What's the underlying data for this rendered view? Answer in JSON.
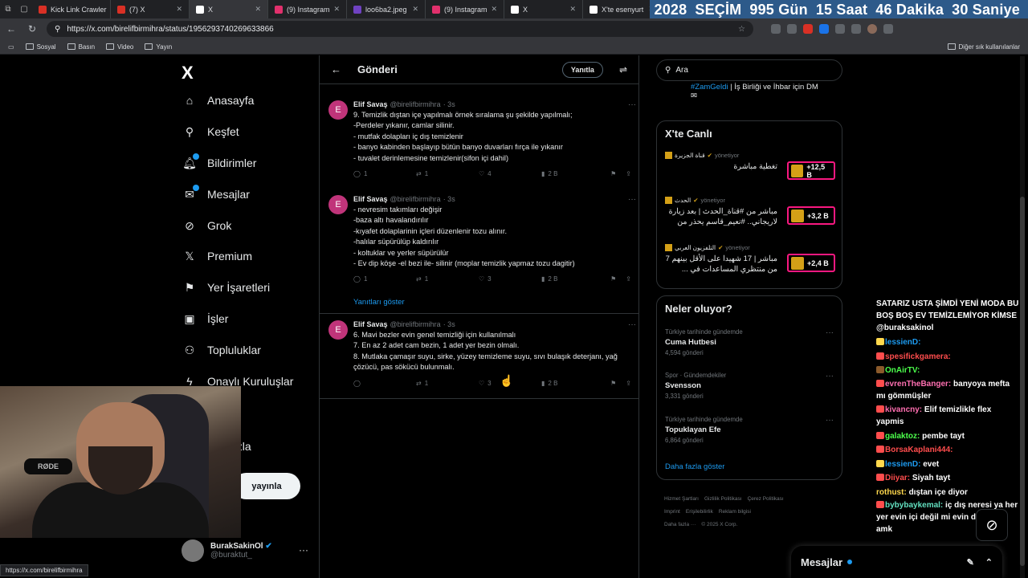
{
  "browser": {
    "tabs": [
      {
        "title": "Kick Link Crawler",
        "color": "#d93025"
      },
      {
        "title": "(7) X",
        "color": "#d93025"
      },
      {
        "title": "X",
        "color": "#ffffff"
      },
      {
        "title": "(9) Instagram",
        "color": "#e1306c"
      },
      {
        "title": "loo6ba2.jpeg",
        "color": "#6f42c1"
      },
      {
        "title": "(9) Instagram",
        "color": "#e1306c"
      },
      {
        "title": "X",
        "color": "#ffffff"
      },
      {
        "title": "X'te esenyurt",
        "color": "#ffffff"
      }
    ],
    "url": "https://x.com/birelifbirmihra/status/1956293740269633866",
    "bookmarks": [
      "Sosyal",
      "Basın",
      "Video",
      "Yayın"
    ],
    "other_bookmarks": "Diğer sık kullanılanlar",
    "status_url": "https://x.com/birelifbirmihra"
  },
  "countdown": {
    "year": "2028",
    "label": "SEÇİM",
    "days": "995 Gün",
    "hours": "15 Saat",
    "minutes": "46 Dakika",
    "seconds": "30 Saniye"
  },
  "nav": {
    "logo": "X",
    "items": [
      "Anasayfa",
      "Keşfet",
      "Bildirimler",
      "Mesajlar",
      "Grok",
      "Premium",
      "Yer İşaretleri",
      "İşler",
      "Topluluklar",
      "Onaylı Kuruluşlar"
    ],
    "more_fragment": "azla",
    "post_fragment": "yayınla",
    "account": {
      "name": "BurakSakinOl",
      "handle": "@buraktut_"
    }
  },
  "main": {
    "title": "Gönderi",
    "reply_button": "Yanıtla",
    "show_replies": "Yanıtları göster",
    "tweets": [
      {
        "avatar": "E",
        "name": "Elif Savaş",
        "handle": "@birelifbirmihra",
        "time": "· 3s",
        "text": "9. Temizlik dıştan içe yapılmalı örnek sıralama şu şekilde yapılmalı;\n-Perdeler yıkanır, camlar silinir.\n- mutfak dolapları iç dış temizlenir\n- banyo kabinden başlayıp bütün banyo duvarları fırça ile yıkanır\n- tuvalet derinlemesine temizlenir(sifon içi dahil)",
        "replies": "1",
        "reposts": "1",
        "likes": "4",
        "views": "2 B"
      },
      {
        "avatar": "E",
        "name": "Elif Savaş",
        "handle": "@birelifbirmihra",
        "time": "· 3s",
        "text": "- nevresim takımları değişir\n-baza altı havalandırılır\n-kıyafet dolaplarinin içleri düzenlenir tozu alınır.\n-halılar süpürülüp kaldırılır\n- koltuklar ve yerler süpürülür\n- Ev dip köşe -el bezi ile- silinir (moplar temizlik yapmaz tozu dagitir)",
        "replies": "1",
        "reposts": "1",
        "likes": "3",
        "views": "2 B"
      },
      {
        "avatar": "E",
        "name": "Elif Savaş",
        "handle": "@birelifbirmihra",
        "time": "· 3s",
        "text": "6. Mavi bezler evin genel temizliği için kullanılmalı\n7. En az 2 adet cam bezin, 1 adet yer bezin olmalı.\n8. Mutlaka çamaşır suyu, sirke, yüzey temizleme suyu, sıvı bulaşık deterjanı, yağ çözücü, pas sökücü bulunmalı.",
        "replies": "",
        "reposts": "1",
        "likes": "3",
        "views": "2 B"
      }
    ]
  },
  "right": {
    "search_placeholder": "Ara",
    "promo_tag": "#ZamGeldi",
    "promo_text": " | İş Birliği ve İhbar için DM",
    "live_title": "X'te Canlı",
    "live": [
      {
        "source": "قناة الجزيرة",
        "status": "yönetiyor",
        "text": "تغطية مباشرة",
        "count": "+12,5 B"
      },
      {
        "source": "الحدث",
        "status": "yönetiyor",
        "text": "مباشر من #قناة_الحدث | بعد زيارة لاريجاني.. #نعيم_قاسم يحذر من",
        "count": "+3,2 B"
      },
      {
        "source": "التلفزيون العربي",
        "status": "yönetiyor",
        "text": "مباشر | 17 شهيدا على الأقل بينهم 7 من منتظري المساعدات في ...",
        "count": "+2,4 B"
      }
    ],
    "trends_title": "Neler oluyor?",
    "trends": [
      {
        "category": "Türkiye tarihinde gündemde",
        "name": "Cuma Hutbesi",
        "count": "4,594 gönderi"
      },
      {
        "category": "Spor · Gündemdekiler",
        "name": "Svensson",
        "count": "3,331 gönderi"
      },
      {
        "category": "Türkiye tarihinde gündemde",
        "name": "Topuklayan Efe",
        "count": "6,864 gönderi"
      }
    ],
    "show_more": "Daha fazla göster",
    "footer": [
      "Hizmet Şartları",
      "Gizlilik Politikası",
      "Çerez Politikası",
      "Imprint",
      "Erişilebilirlik",
      "Reklam bilgisi",
      "Daha fazla ···",
      "© 2025 X Corp."
    ]
  },
  "chat": {
    "headline": "SATARIZ USTA ŞİMDİ YENİ MODA BU BOŞ BOŞ EV TEMİZLEMİYOR KİMSE @buraksakinol",
    "messages": [
      {
        "user": "lessienD:",
        "text": "",
        "color": "u-blue"
      },
      {
        "user": "spesifickgamera:",
        "text": "",
        "color": "u-red"
      },
      {
        "user": "OnAirTV:",
        "text": "",
        "color": "u-green"
      },
      {
        "user": "evrenTheBanger:",
        "text": "banyoya mefta mı gömmüşler",
        "color": "u-pink"
      },
      {
        "user": "kivancny:",
        "text": "Elif temizlikle flex yapmis",
        "color": "u-pink"
      },
      {
        "user": "galaktoz:",
        "text": "pembe tayt",
        "color": "u-green"
      },
      {
        "user": "BorsaKaplani444:",
        "text": "",
        "color": "u-red"
      },
      {
        "user": "lessienD:",
        "text": "evet",
        "color": "u-blue"
      },
      {
        "user": "Diiyar:",
        "text": "Siyah tayt",
        "color": "u-red"
      },
      {
        "user": "rothust:",
        "text": "dıştan içe diyor",
        "color": "u-yellow"
      },
      {
        "user": "bybybaykemal:",
        "text": "iç dış neresi ya her yer evin içi değil mi evin dışı nere amk",
        "color": "u-teal"
      }
    ]
  },
  "messages_drawer": {
    "label": "Mesajlar"
  },
  "webcam": {
    "mic_label": "RØDE"
  }
}
